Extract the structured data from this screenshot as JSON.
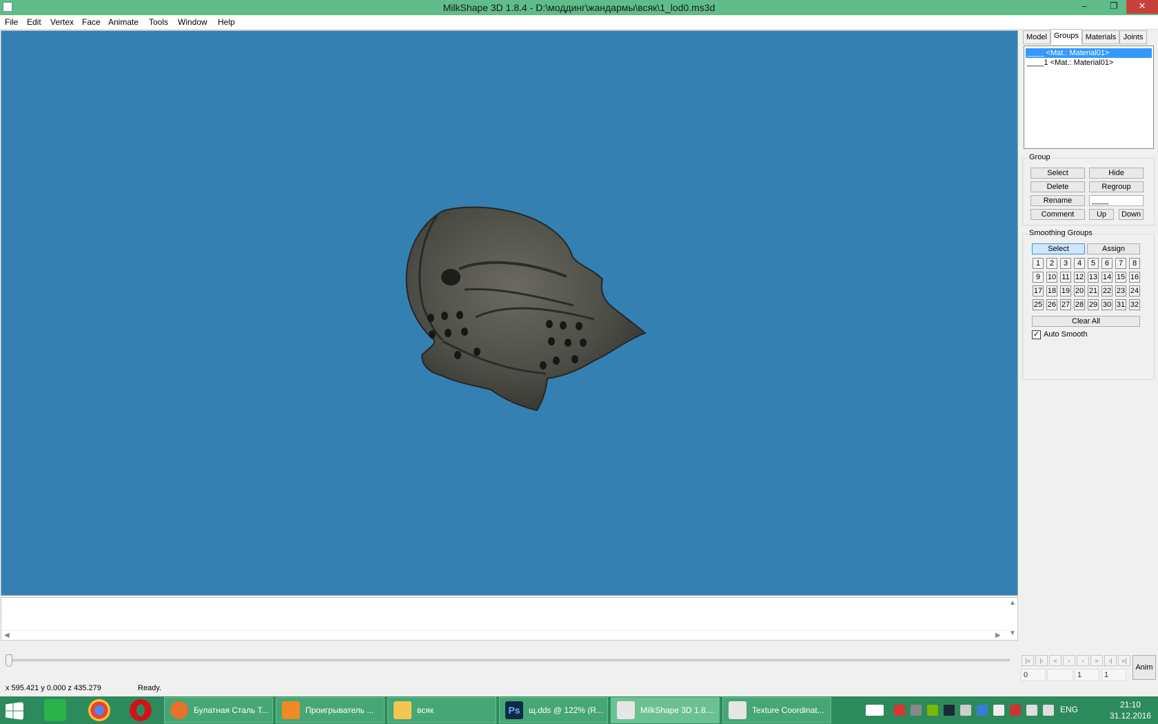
{
  "window": {
    "title": "MilkShape 3D 1.8.4 - D:\\моддинг\\жандармы\\всяк\\1_lod0.ms3d"
  },
  "menu": [
    "File",
    "Edit",
    "Vertex",
    "Face",
    "Animate",
    "Tools",
    "Window",
    "Help"
  ],
  "tabs": [
    "Model",
    "Groups",
    "Materials",
    "Joints"
  ],
  "active_tab": "Groups",
  "groups_list": [
    {
      "label": "____ <Mat.: Material01>",
      "selected": true
    },
    {
      "label": "____1 <Mat.: Material01>",
      "selected": false
    }
  ],
  "group_box": {
    "title": "Group",
    "buttons": {
      "select": "Select",
      "hide": "Hide",
      "delete": "Delete",
      "regroup": "Regroup",
      "rename": "Rename",
      "comment": "Comment",
      "up": "Up",
      "down": "Down"
    },
    "name_value": "____"
  },
  "smoothing_box": {
    "title": "Smoothing Groups",
    "select": "Select",
    "assign": "Assign",
    "numbers": [
      "1",
      "2",
      "3",
      "4",
      "5",
      "6",
      "7",
      "8",
      "9",
      "10",
      "11",
      "12",
      "13",
      "14",
      "15",
      "16",
      "17",
      "18",
      "19",
      "20",
      "21",
      "22",
      "23",
      "24",
      "25",
      "26",
      "27",
      "28",
      "29",
      "30",
      "31",
      "32"
    ],
    "clear_all": "Clear All",
    "auto_smooth": "Auto Smooth",
    "auto_smooth_checked": true
  },
  "anim": {
    "button": "Anim",
    "fields": [
      "0",
      "",
      "1",
      "1"
    ]
  },
  "status": {
    "coords": "x 595.421 y 0.000 z 435.279",
    "text": "Ready."
  },
  "viewport": {
    "background": "#3580b3"
  },
  "taskbar": {
    "items": [
      {
        "label": "Булатная Сталь Т...",
        "icon": "firefox-icon",
        "color": "#e8712b"
      },
      {
        "label": "Проигрыватель ...",
        "icon": "media-player-icon",
        "color": "#f08a24"
      },
      {
        "label": "всяк",
        "icon": "folder-icon",
        "color": "#f3c74e"
      },
      {
        "label": "щ.dds @ 122% (R...",
        "icon": "photoshop-icon",
        "color": "#0f2a45"
      },
      {
        "label": "MilkShape 3D 1.8....",
        "icon": "milkshape-icon",
        "color": "#e6e6e6"
      },
      {
        "label": "Texture Coordinat...",
        "icon": "milkshape-icon",
        "color": "#e6e6e6"
      }
    ],
    "lang": "ENG",
    "time": "21:10",
    "date": "31.12.2016"
  }
}
